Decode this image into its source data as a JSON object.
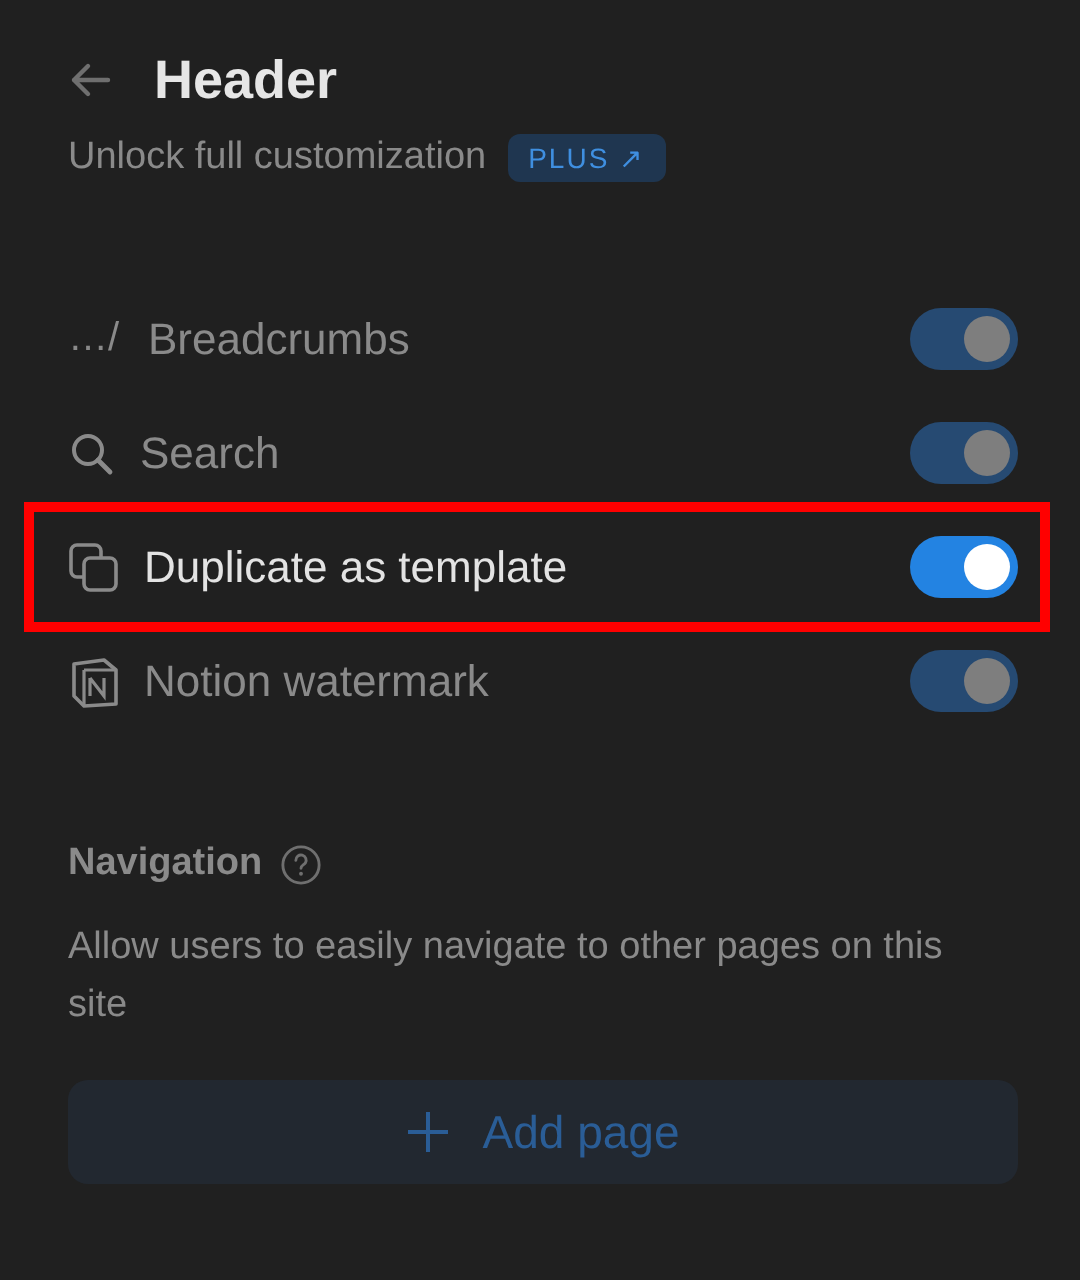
{
  "header": {
    "title": "Header",
    "subtitle": "Unlock full customization",
    "badge": "PLUS ↗"
  },
  "options": [
    {
      "glyph": "…/",
      "label": "Breadcrumbs",
      "on": true,
      "disabled": true,
      "highlighted": false
    },
    {
      "kind": "search",
      "label": "Search",
      "on": true,
      "disabled": true,
      "highlighted": false
    },
    {
      "kind": "duplicate",
      "label": "Duplicate as template",
      "on": true,
      "disabled": false,
      "highlighted": true
    },
    {
      "kind": "logo",
      "label": "Notion watermark",
      "on": true,
      "disabled": true,
      "highlighted": false
    }
  ],
  "navigation": {
    "title": "Navigation",
    "description": "Allow users to easily navigate to other pages on this site",
    "button": {
      "label": "Add page",
      "disabled": true
    }
  }
}
